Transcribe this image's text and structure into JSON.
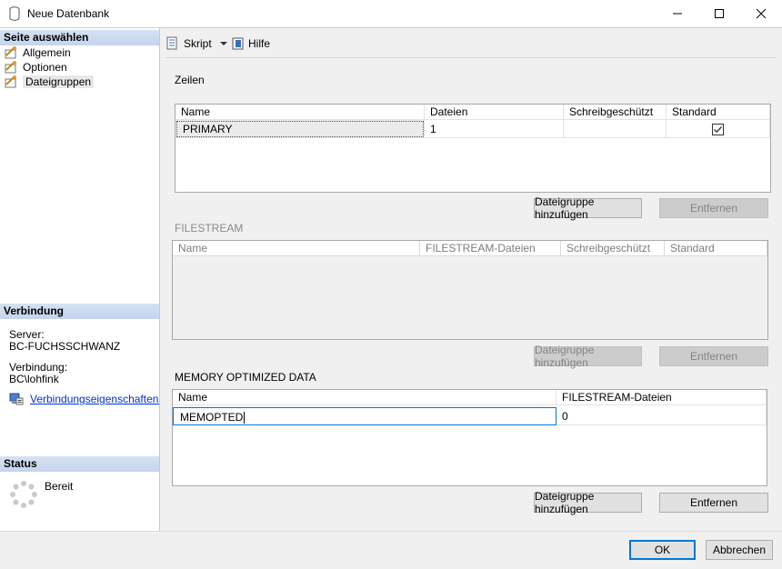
{
  "window": {
    "title": "Neue Datenbank",
    "minimize_icon": "minimize-icon",
    "maximize_icon": "maximize-icon",
    "close_icon": "close-icon"
  },
  "left": {
    "select_page_header": "Seite auswählen",
    "pages": [
      {
        "label": "Allgemein",
        "icon": "wrench-page-icon"
      },
      {
        "label": "Optionen",
        "icon": "wrench-page-icon"
      },
      {
        "label": "Dateigruppen",
        "icon": "wrench-page-icon"
      }
    ],
    "connection_header": "Verbindung",
    "server_label": "Server:",
    "server_value": "BC-FUCHSSCHWANZ",
    "connection_label": "Verbindung:",
    "connection_value": "BC\\lohfink",
    "connection_props_link": "Verbindungseigenschaften anzeigen",
    "status_header": "Status",
    "status_value": "Bereit"
  },
  "toolbar": {
    "script_label": "Skript",
    "help_label": "Hilfe"
  },
  "rows_section": {
    "title": "Zeilen",
    "columns": [
      "Name",
      "Dateien",
      "Schreibgeschützt",
      "Standard"
    ],
    "rows": [
      {
        "name": "PRIMARY",
        "files": "1",
        "readonly": "",
        "default_checked": true
      }
    ],
    "add_button": "Dateigruppe hinzufügen",
    "remove_button": "Entfernen"
  },
  "filestream_section": {
    "title": "FILESTREAM",
    "columns": [
      "Name",
      "FILESTREAM-Dateien",
      "Schreibgeschützt",
      "Standard"
    ],
    "add_button": "Dateigruppe hinzufügen",
    "remove_button": "Entfernen"
  },
  "memory_section": {
    "title": "MEMORY OPTIMIZED DATA",
    "columns": [
      "Name",
      "FILESTREAM-Dateien"
    ],
    "rows": [
      {
        "name": "MEMOPTED",
        "files": "0"
      }
    ],
    "add_button": "Dateigruppe hinzufügen",
    "remove_button": "Entfernen"
  },
  "footer": {
    "ok_button": "OK",
    "cancel_button": "Abbrechen"
  }
}
